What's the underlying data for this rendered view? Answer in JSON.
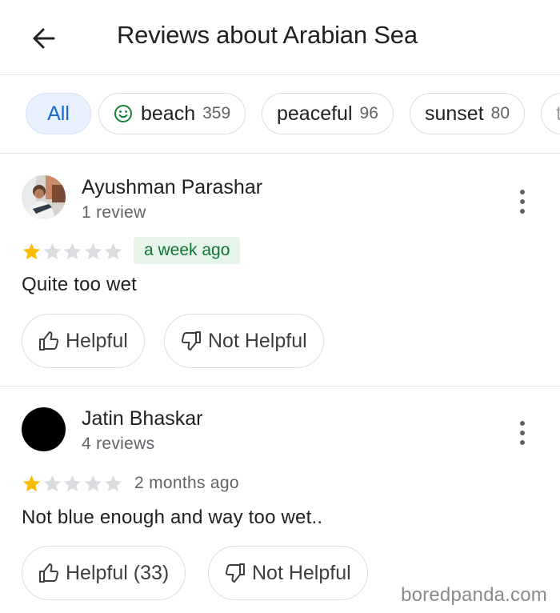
{
  "header": {
    "title": "Reviews about Arabian Sea"
  },
  "chips": [
    {
      "label": "All",
      "count": ""
    },
    {
      "label": "beach",
      "count": "359",
      "icon": "smiley-icon"
    },
    {
      "label": "peaceful",
      "count": "96"
    },
    {
      "label": "sunset",
      "count": "80"
    }
  ],
  "reviews": [
    {
      "name": "Ayushman Parashar",
      "review_count": "1 review",
      "rating": 1,
      "max_rating": 5,
      "time": "a week ago",
      "text": "Quite too wet",
      "helpful_label": "Helpful",
      "not_helpful_label": "Not Helpful"
    },
    {
      "name": "Jatin Bhaskar",
      "review_count": "4 reviews",
      "rating": 1,
      "max_rating": 5,
      "time": "2 months ago",
      "text": "Not blue enough and way too wet..",
      "helpful_label": "Helpful (33)",
      "not_helpful_label": "Not Helpful"
    }
  ],
  "watermark": "boredpanda.com",
  "colors": {
    "accent": "#1967d2",
    "star": "#fbbc04",
    "badge_bg": "#e6f4ea",
    "badge_text": "#137333"
  }
}
